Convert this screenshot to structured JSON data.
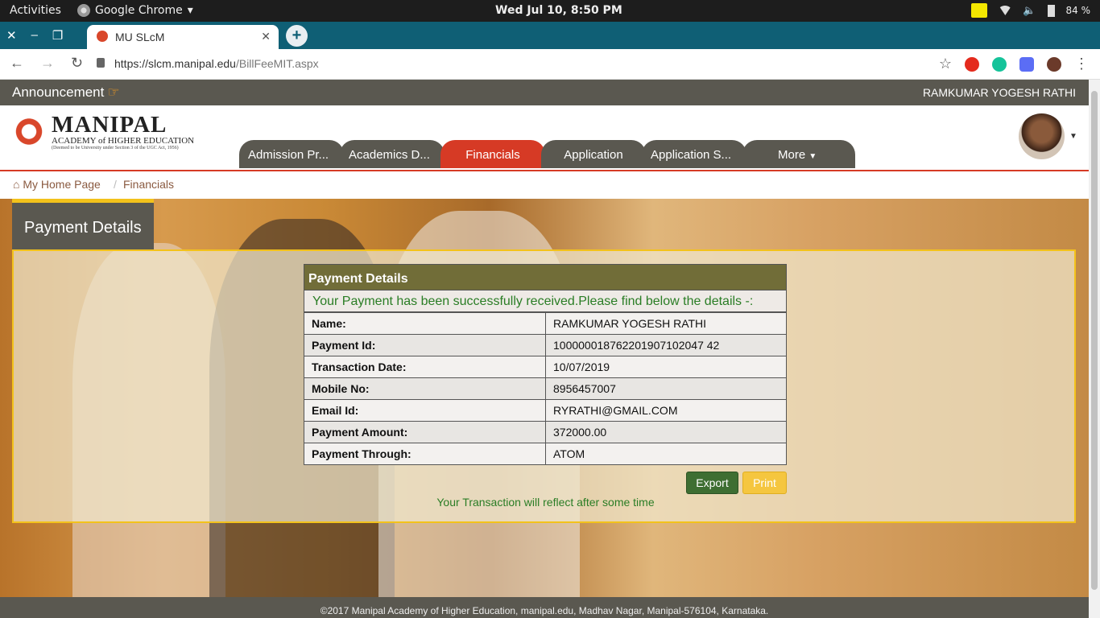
{
  "os": {
    "activities": "Activities",
    "app_name": "Google Chrome",
    "clock": "Wed Jul 10,  8:50 PM",
    "battery": "84 %"
  },
  "browser": {
    "tab_title": "MU SLcM",
    "url_host": "https://slcm.manipal.edu",
    "url_path": "/BillFeeMIT.aspx"
  },
  "site": {
    "announcement": "Announcement",
    "user_name": "RAMKUMAR YOGESH RATHI",
    "logo_title": "MANIPAL",
    "logo_subtitle": "ACADEMY of HIGHER EDUCATION",
    "logo_tagline": "(Deemed to be University under Section 3 of the UGC Act, 1956)",
    "nav": [
      "Admission Pr...",
      "Academics D...",
      "Financials",
      "Application",
      "Application S...",
      "More"
    ],
    "breadcrumb": {
      "home": "My Home Page",
      "current": "Financials"
    },
    "section_title": "Payment Details"
  },
  "payment": {
    "header": "Payment Details",
    "message": "Your Payment has been successfully received.Please find below the details -:",
    "rows": [
      {
        "key": "Name:",
        "value": "RAMKUMAR YOGESH RATHI"
      },
      {
        "key": "Payment Id:",
        "value": "100000018762201907102047 42"
      },
      {
        "key": "Transaction Date:",
        "value": "10/07/2019"
      },
      {
        "key": "Mobile No:",
        "value": "8956457007"
      },
      {
        "key": "Email Id:",
        "value": "RYRATHI@GMAIL.COM"
      },
      {
        "key": "Payment Amount:",
        "value": "372000.00"
      },
      {
        "key": "Payment Through:",
        "value": "ATOM"
      }
    ],
    "export_label": "Export",
    "print_label": "Print",
    "note": "Your Transaction will reflect after some time"
  },
  "footer": "©2017 Manipal Academy of Higher Education, manipal.edu, Madhav Nagar, Manipal-576104, Karnataka."
}
